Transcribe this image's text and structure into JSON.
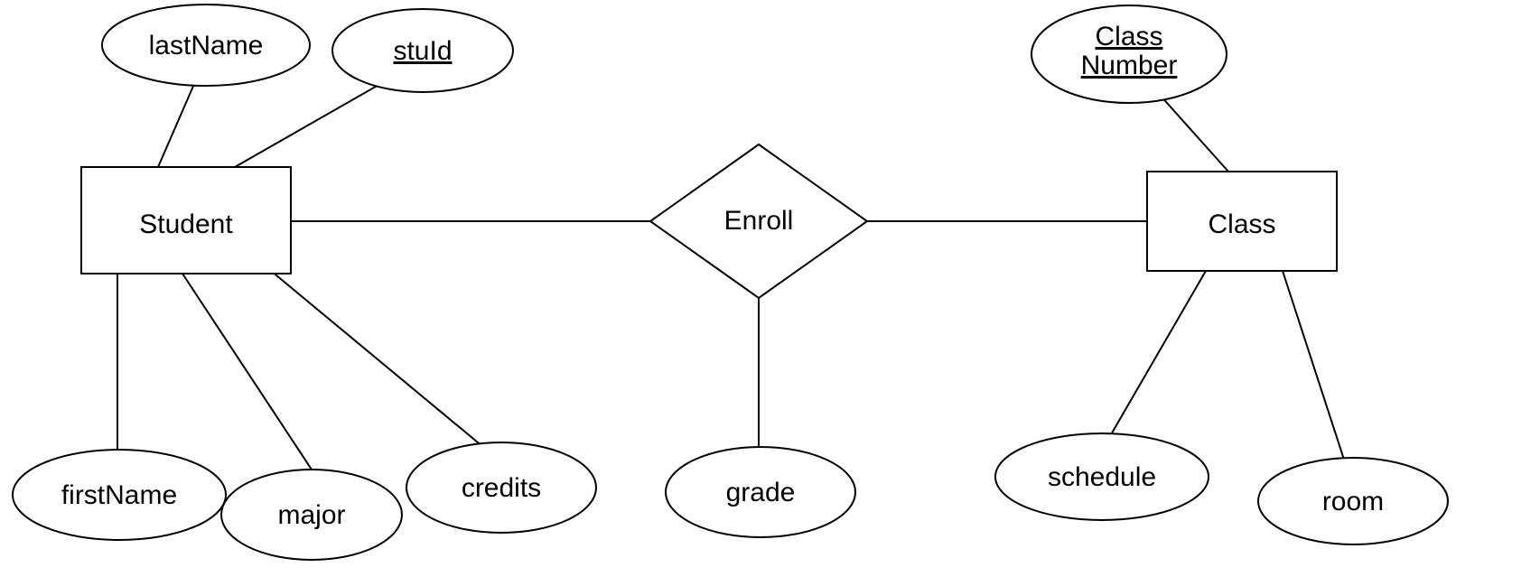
{
  "entities": {
    "student": {
      "label": "Student"
    },
    "class": {
      "label": "Class"
    }
  },
  "relationships": {
    "enroll": {
      "label": "Enroll"
    }
  },
  "attributes": {
    "lastName": {
      "label": "lastName",
      "key": false
    },
    "stuId": {
      "label": "stuId",
      "key": true
    },
    "firstName": {
      "label": "firstName",
      "key": false
    },
    "major": {
      "label": "major",
      "key": false
    },
    "credits": {
      "label": "credits",
      "key": false
    },
    "grade": {
      "label": "grade",
      "key": false
    },
    "classNumber": {
      "label": "Class Number",
      "key": true
    },
    "schedule": {
      "label": "schedule",
      "key": false
    },
    "room": {
      "label": "room",
      "key": false
    }
  }
}
